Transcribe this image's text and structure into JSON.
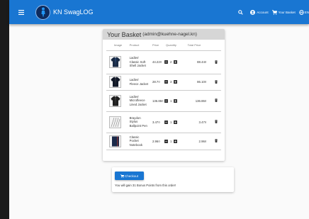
{
  "app": {
    "title": "KN SwagLOG"
  },
  "toolbar": {
    "account_label": "Account",
    "basket_label": "Your Basket",
    "language_label": "EN"
  },
  "basket": {
    "title": "Your Basket",
    "user": "(admin@kuehne-nagel.kn)",
    "columns": [
      "Image",
      "Product",
      "Price",
      "Quantity",
      "Total Price"
    ],
    "items": [
      {
        "product": "Ladies' Classic Soft Shell Jacket",
        "price": "44.22¤",
        "quantity": "2",
        "total": "88.44¤",
        "image": "jacket-icon"
      },
      {
        "product": "Ladies' Fleece Jacket",
        "price": "28.7¤",
        "quantity": "3",
        "total": "86.10¤",
        "image": "jacket-icon"
      },
      {
        "product": "Ladies' Microfleece Lined Jacket",
        "price": "136.86¤",
        "quantity": "1",
        "total": "136.86¤",
        "image": "jacket-icon"
      },
      {
        "product": "Braydon Stylus Ballpoint Pen",
        "price": "3.47¤",
        "quantity": "1",
        "total": "3.47¤",
        "image": "pen-icon"
      },
      {
        "product": "Classic Pocket Notebook",
        "price": "2.96¤",
        "quantity": "1",
        "total": "2.96¤",
        "image": "notebook-icon"
      }
    ]
  },
  "checkout": {
    "button_label": "Checkout",
    "bonus_text": "You will gain 31 Bonus Points from this order!"
  },
  "colors": {
    "primary": "#1976d2",
    "header_bg": "#d6d6d6",
    "background": "#fafafa"
  }
}
